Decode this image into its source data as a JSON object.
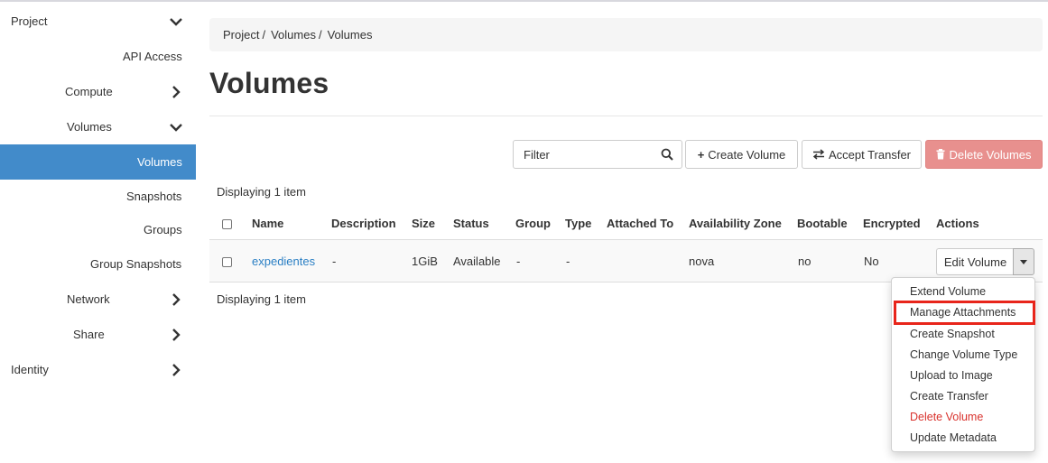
{
  "sidebar": {
    "project": "Project",
    "api_access": "API Access",
    "compute": "Compute",
    "volumes_group": "Volumes",
    "volumes": "Volumes",
    "snapshots": "Snapshots",
    "groups": "Groups",
    "group_snapshots": "Group Snapshots",
    "network": "Network",
    "share": "Share",
    "identity": "Identity"
  },
  "breadcrumb": [
    "Project",
    "Volumes",
    "Volumes"
  ],
  "page_title": "Volumes",
  "toolbar": {
    "filter_placeholder": "Filter",
    "create_volume": "Create Volume",
    "accept_transfer": "Accept Transfer",
    "delete_volumes": "Delete Volumes"
  },
  "displaying": "Displaying 1 item",
  "table": {
    "columns": [
      "Name",
      "Description",
      "Size",
      "Status",
      "Group",
      "Type",
      "Attached To",
      "Availability Zone",
      "Bootable",
      "Encrypted",
      "Actions"
    ],
    "row": {
      "name": "expedientes",
      "description": "-",
      "size": "1GiB",
      "status": "Available",
      "group": "-",
      "type": "-",
      "attached_to": "",
      "availability_zone": "nova",
      "bootable": "no",
      "encrypted": "No",
      "action": "Edit Volume"
    }
  },
  "dropdown": [
    "Extend Volume",
    "Manage Attachments",
    "Create Snapshot",
    "Change Volume Type",
    "Upload to Image",
    "Create Transfer",
    "Delete Volume",
    "Update Metadata"
  ],
  "colors": {
    "active_nav": "#428bca",
    "link": "#2a7fc4",
    "danger_button": "#e8908e",
    "danger_text": "#d9322d",
    "highlight": "#e8251b"
  }
}
